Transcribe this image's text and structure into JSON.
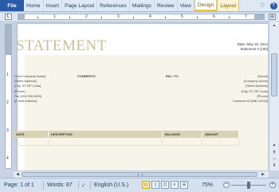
{
  "ribbon": {
    "tabs": [
      {
        "label": "File"
      },
      {
        "label": "Home"
      },
      {
        "label": "Insert"
      },
      {
        "label": "Page Layout"
      },
      {
        "label": "References"
      },
      {
        "label": "Mailings"
      },
      {
        "label": "Review"
      },
      {
        "label": "View"
      }
    ],
    "context_tabs": [
      {
        "label": "Design",
        "active": true
      },
      {
        "label": "Layout",
        "active": false
      }
    ],
    "help_icon": "help-icon",
    "heart_icon": "heart-icon"
  },
  "ruler": {
    "corner_glyph": "L",
    "numbers": [
      "1",
      "2",
      "3",
      "4",
      "5",
      "6",
      "7"
    ],
    "vertical_numbers": [
      "1",
      "2",
      "3",
      "4"
    ]
  },
  "document": {
    "title": "STATEMENT",
    "meta": {
      "date_line": "Date: May 16, 2014",
      "statement_line": "Statement # [100]"
    },
    "sender_lines": [
      "[Your Company Name]",
      "[Street Address]",
      "[City, ST ZIP Code]",
      "[Phone]",
      "Fax [000-000-0000]",
      "[E-mail Address]"
    ],
    "comments_label": "COMMENTS",
    "billto_label": "BILL TO:",
    "billto_lines": [
      "[Name]",
      "[Company Name]",
      "[Street Address]",
      "[City, ST ZIP Code]",
      "[Phone]",
      "Customer ID [ABC12345]"
    ],
    "table_headers": [
      "DATE",
      "DESCRIPTION",
      "BALANCE",
      "AMOUNT"
    ]
  },
  "statusbar": {
    "page": "Page: 1 of 1",
    "words": "Words: 87",
    "language": "English (U.S.)",
    "zoom": "75%",
    "zoom_level": 0.5
  }
}
